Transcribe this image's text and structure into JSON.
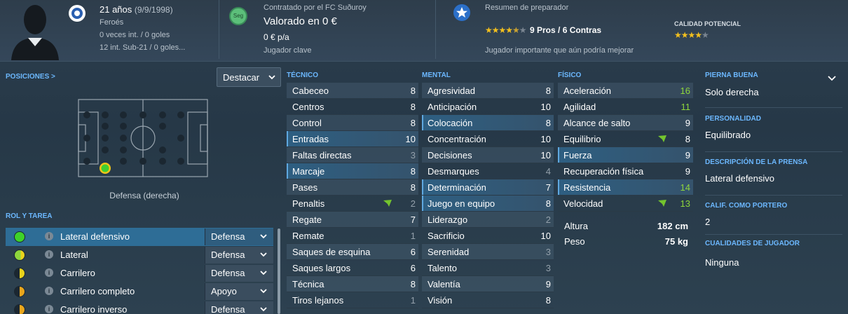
{
  "header": {
    "age": "21 años",
    "dob": "(9/9/1998)",
    "nationality": "Feroés",
    "caps": "0 veces int. / 0 goles",
    "u21": "12 int. Sub-21 / 0 goles...",
    "contract_badge": "Seg",
    "contract": "Contratado por el FC Suðuroy",
    "value": "Valorado en 0 €",
    "wage": "0 € p/a",
    "squad_status": "Jugador clave",
    "coach_summary_title": "Resumen de preparador",
    "pros_cons": "9 Pros / 6 Contras",
    "coach_note": "Jugador importante que aún podría mejorar",
    "potential_label": "CALIDAD POTENCIAL",
    "coach_stars": 4.5,
    "potential_stars": 4
  },
  "positions": {
    "title": "POSICIONES >",
    "dropdown": "Destacar",
    "position_name": "Defensa (derecha)"
  },
  "roles": {
    "title": "ROL Y TAREA",
    "items": [
      {
        "name": "Lateral defensivo",
        "duty": "Defensa"
      },
      {
        "name": "Lateral",
        "duty": "Defensa"
      },
      {
        "name": "Carrilero",
        "duty": "Defensa"
      },
      {
        "name": "Carrilero completo",
        "duty": "Apoyo"
      },
      {
        "name": "Carrilero inverso",
        "duty": "Defensa"
      }
    ]
  },
  "technical": {
    "title": "TÉCNICO",
    "attrs": [
      {
        "name": "Cabeceo",
        "value": "8"
      },
      {
        "name": "Centros",
        "value": "8"
      },
      {
        "name": "Control",
        "value": "8"
      },
      {
        "name": "Entradas",
        "value": "10"
      },
      {
        "name": "Faltas directas",
        "value": "3"
      },
      {
        "name": "Marcaje",
        "value": "8"
      },
      {
        "name": "Pases",
        "value": "8"
      },
      {
        "name": "Penaltis",
        "value": "2"
      },
      {
        "name": "Regate",
        "value": "7"
      },
      {
        "name": "Remate",
        "value": "1"
      },
      {
        "name": "Saques de esquina",
        "value": "6"
      },
      {
        "name": "Saques largos",
        "value": "6"
      },
      {
        "name": "Técnica",
        "value": "8"
      },
      {
        "name": "Tiros lejanos",
        "value": "1"
      }
    ]
  },
  "mental": {
    "title": "MENTAL",
    "attrs": [
      {
        "name": "Agresividad",
        "value": "8"
      },
      {
        "name": "Anticipación",
        "value": "10"
      },
      {
        "name": "Colocación",
        "value": "8"
      },
      {
        "name": "Concentración",
        "value": "10"
      },
      {
        "name": "Decisiones",
        "value": "10"
      },
      {
        "name": "Desmarques",
        "value": "4"
      },
      {
        "name": "Determinación",
        "value": "7"
      },
      {
        "name": "Juego en equipo",
        "value": "8"
      },
      {
        "name": "Liderazgo",
        "value": "2"
      },
      {
        "name": "Sacrificio",
        "value": "10"
      },
      {
        "name": "Serenidad",
        "value": "3"
      },
      {
        "name": "Talento",
        "value": "3"
      },
      {
        "name": "Valentía",
        "value": "9"
      },
      {
        "name": "Visión",
        "value": "8"
      }
    ]
  },
  "physical": {
    "title": "FÍSICO",
    "attrs": [
      {
        "name": "Aceleración",
        "value": "16"
      },
      {
        "name": "Agilidad",
        "value": "11"
      },
      {
        "name": "Alcance de salto",
        "value": "9"
      },
      {
        "name": "Equilibrio",
        "value": "8"
      },
      {
        "name": "Fuerza",
        "value": "9"
      },
      {
        "name": "Recuperación física",
        "value": "9"
      },
      {
        "name": "Resistencia",
        "value": "14"
      },
      {
        "name": "Velocidad",
        "value": "13"
      }
    ],
    "height_label": "Altura",
    "height_value": "182 cm",
    "weight_label": "Peso",
    "weight_value": "75 kg"
  },
  "right": {
    "foot_label": "PIERNA BUENA",
    "foot_value": "Solo derecha",
    "personality_label": "PERSONALIDAD",
    "personality_value": "Equilibrado",
    "press_label": "DESCRIPCIÓN DE LA PRENSA",
    "press_value": "Lateral defensivo",
    "gk_label": "CALIF. COMO PORTERO",
    "gk_value": "2",
    "qualities_label": "CUALIDADES DE JUGADOR",
    "qualities_value": "Ninguna"
  },
  "colors": {
    "accent": "#6cb8ff",
    "highlight_green": "#8ed63c",
    "star": "#f4c01e"
  }
}
